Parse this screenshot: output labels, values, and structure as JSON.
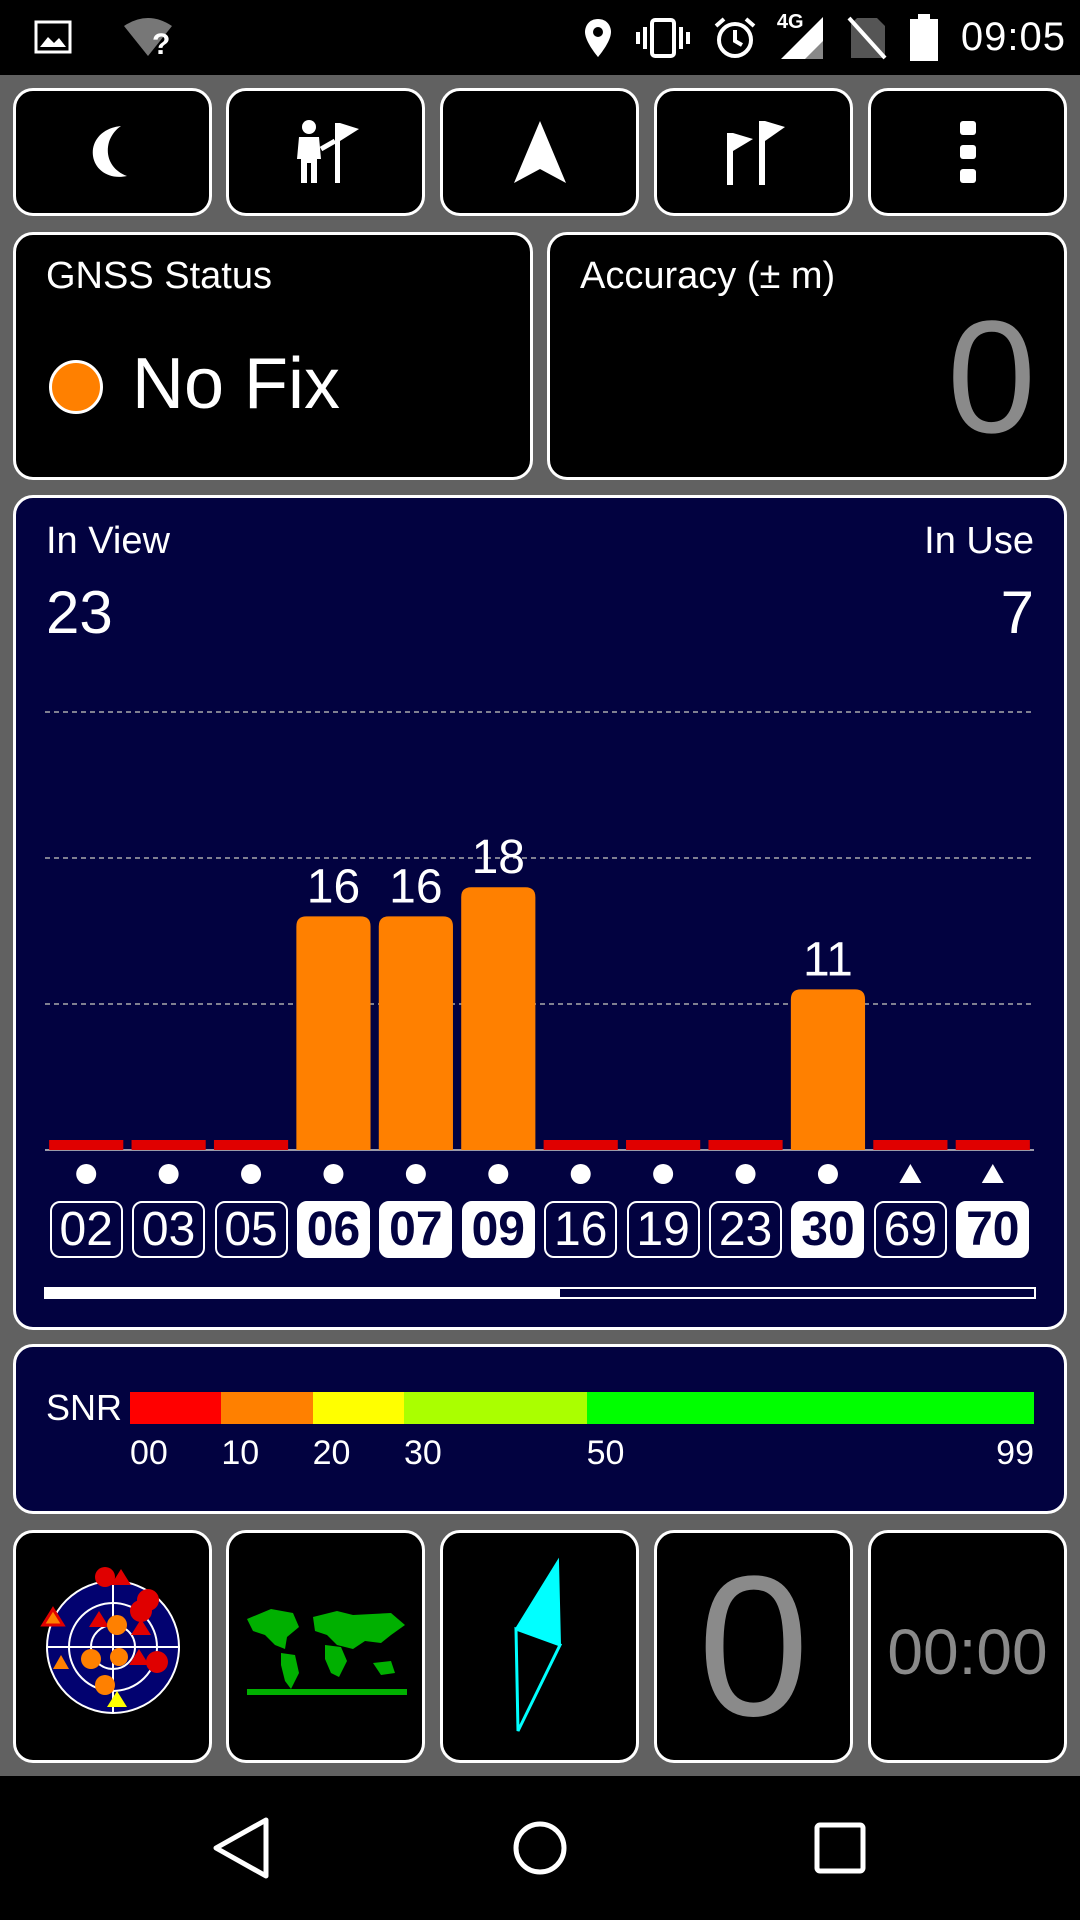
{
  "status_bar": {
    "time": "09:05",
    "network_type": "4G",
    "wifi_question": "?",
    "icons": [
      "image-icon",
      "wifi-unknown-icon",
      "location-icon",
      "vibrate-icon",
      "alarm-icon",
      "signal-4g-icon",
      "no-sim-icon",
      "battery-icon"
    ]
  },
  "toolbar": {
    "buttons": [
      "night-mode-icon",
      "person-flag-icon",
      "navigation-arrow-icon",
      "flags-icon",
      "more-vert-icon"
    ]
  },
  "gnss": {
    "title": "GNSS Status",
    "status": "No Fix",
    "status_color": "#ff8000"
  },
  "accuracy": {
    "title": "Accuracy (± m)",
    "value": "0"
  },
  "sats": {
    "in_view_label": "In View",
    "in_view": "23",
    "in_use_label": "In Use",
    "in_use": "7",
    "scroll_position": 0.52
  },
  "chart_data": {
    "type": "bar",
    "categories": [
      "02",
      "03",
      "05",
      "06",
      "07",
      "09",
      "16",
      "19",
      "23",
      "30",
      "69",
      "70"
    ],
    "values": [
      0,
      0,
      0,
      16,
      16,
      18,
      0,
      0,
      0,
      11,
      0,
      0
    ],
    "labels": [
      "",
      "",
      "",
      "16",
      "16",
      "18",
      "",
      "",
      "",
      "11",
      "",
      ""
    ],
    "in_use": [
      false,
      false,
      false,
      true,
      true,
      true,
      false,
      false,
      false,
      true,
      false,
      true
    ],
    "marker_shapes": [
      "circle",
      "circle",
      "circle",
      "circle",
      "circle",
      "circle",
      "circle",
      "circle",
      "circle",
      "circle",
      "triangle",
      "triangle"
    ],
    "ylim": [
      0,
      40
    ],
    "gridlines": [
      10,
      20,
      30
    ],
    "colors": {
      "active": "#ff8000",
      "zero": "#e00000",
      "background": "#020240"
    }
  },
  "snr": {
    "label": "SNR",
    "ticks": [
      {
        "text": "00",
        "value": 0
      },
      {
        "text": "10",
        "value": 10
      },
      {
        "text": "20",
        "value": 20
      },
      {
        "text": "30",
        "value": 30
      },
      {
        "text": "50",
        "value": 50
      },
      {
        "text": "99",
        "value": 99
      }
    ],
    "segments": [
      {
        "from": 0,
        "to": 10,
        "color": "#ff0000"
      },
      {
        "from": 10,
        "to": 20,
        "color": "#ff8000"
      },
      {
        "from": 20,
        "to": 30,
        "color": "#ffff00"
      },
      {
        "from": 30,
        "to": 50,
        "color": "#aaff00"
      },
      {
        "from": 50,
        "to": 99,
        "color": "#00ff00"
      }
    ]
  },
  "bottom_tiles": {
    "speed_value": "0",
    "timer": "00:00",
    "icons": [
      "sky-plot-icon",
      "world-map-icon",
      "compass-icon"
    ]
  },
  "nav": {
    "icons": [
      "back-icon",
      "home-icon",
      "recents-icon"
    ]
  }
}
